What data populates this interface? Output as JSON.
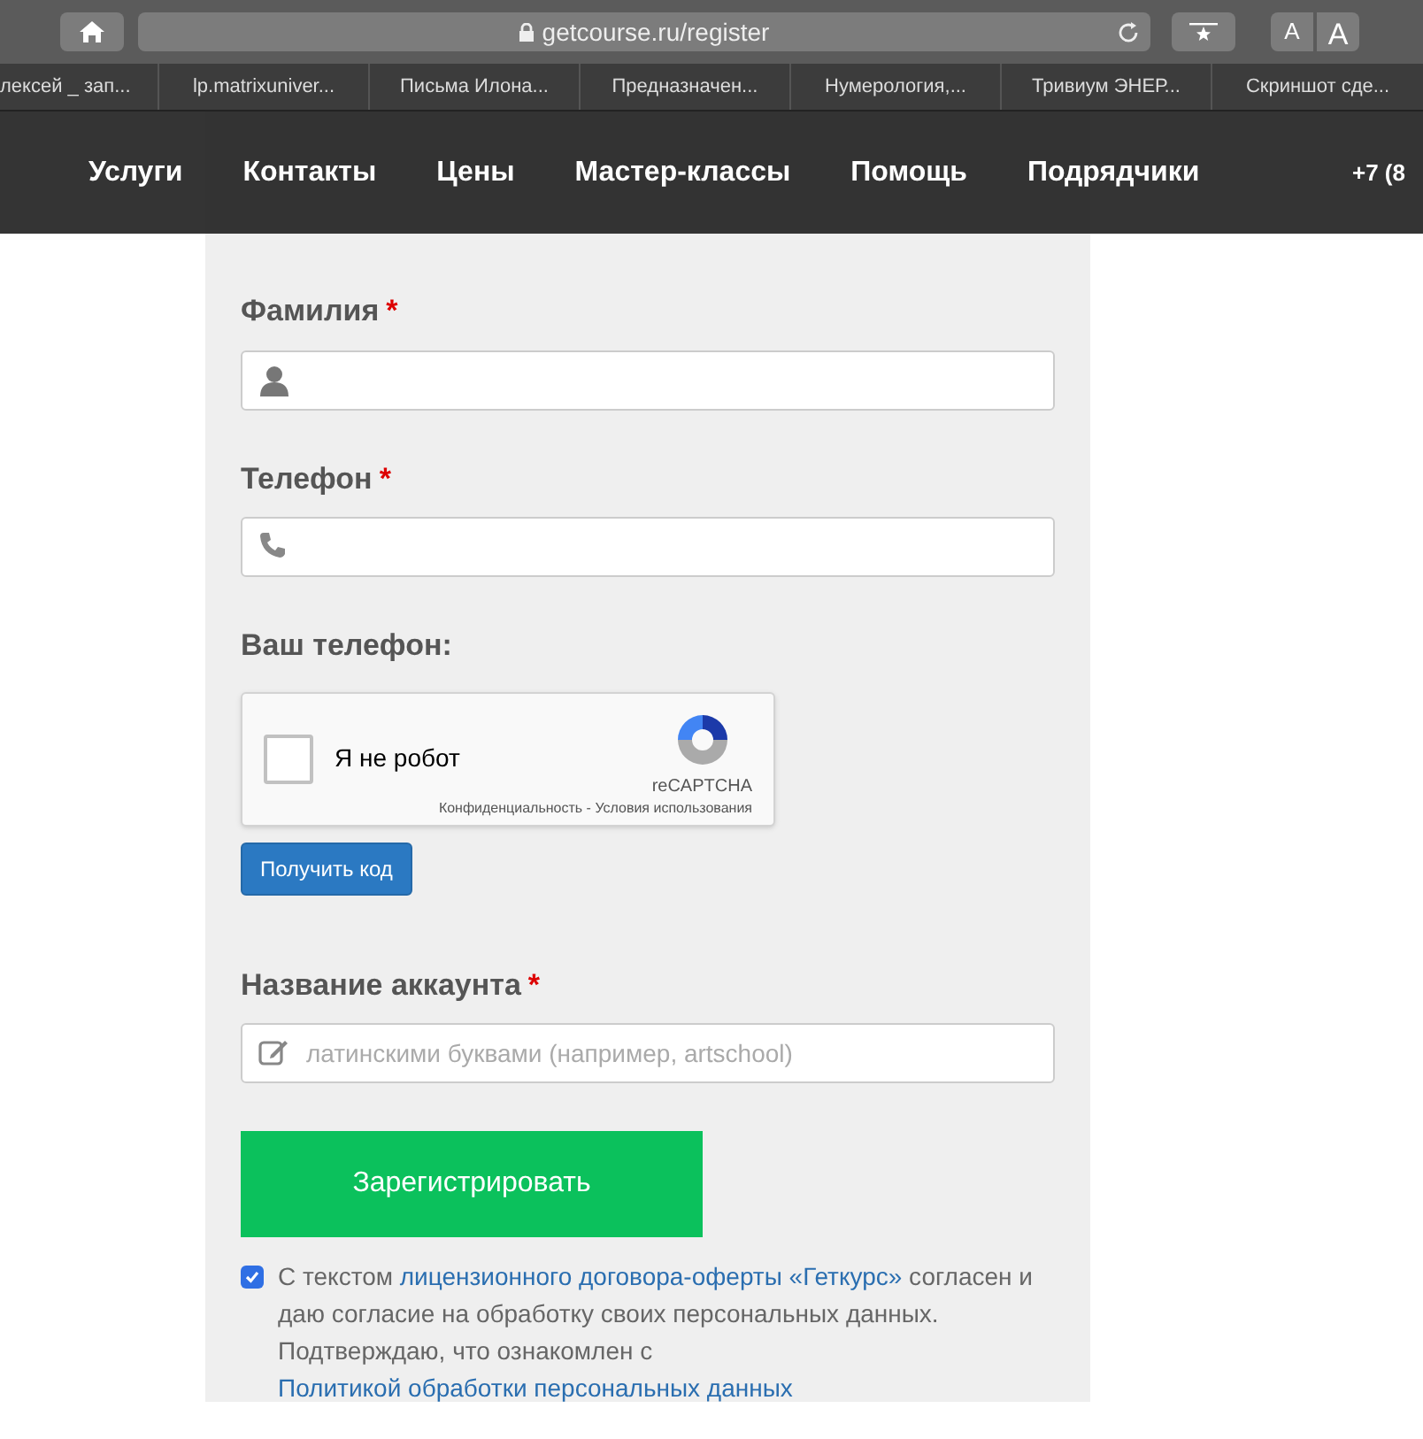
{
  "browser": {
    "url": "getcourse.ru/register",
    "font_buttons": [
      "A",
      "A"
    ],
    "bookmarks": [
      "лексей _ зап...",
      "lp.matrixuniver...",
      "Письма Илона...",
      "Предназначен...",
      "Нумерология,...",
      "Тривиум ЭНЕР...",
      "Скриншот сде..."
    ]
  },
  "nav": {
    "items": [
      "Услуги",
      "Контакты",
      "Цены",
      "Мастер-классы",
      "Помощь",
      "Подрядчики"
    ],
    "phone": "+7 (8"
  },
  "form": {
    "fields": [
      {
        "label": "Фамилия",
        "required_mark": "*",
        "kind": "name"
      },
      {
        "label": "Телефон",
        "required_mark": "*",
        "kind": "phone"
      }
    ],
    "phone_label": "Ваш телефон:",
    "captcha": {
      "label": "Я не робот",
      "checked": false,
      "brand": "reCAPTCHA",
      "links": "Конфиденциальность - Условия использования"
    },
    "code_button": "Получить код",
    "account": {
      "label": "Название аккаунта",
      "required_mark": "*",
      "kind": "account",
      "placeholder": "латинскими буквами (например, artschool)"
    },
    "submit": "Зарегистрировать",
    "consent": {
      "checked": true,
      "parts": [
        {
          "kind": "text",
          "text": "С текстом "
        },
        {
          "kind": "link",
          "text": "лицензионного договора-оферты «Геткурс»"
        },
        {
          "kind": "text",
          "text": " согласен и даю согласие на обработку своих персональных данных. Подтверждаю, что ознакомлен с "
        },
        {
          "kind": "link",
          "text": "Политикой обработки персональных данных"
        }
      ]
    }
  }
}
